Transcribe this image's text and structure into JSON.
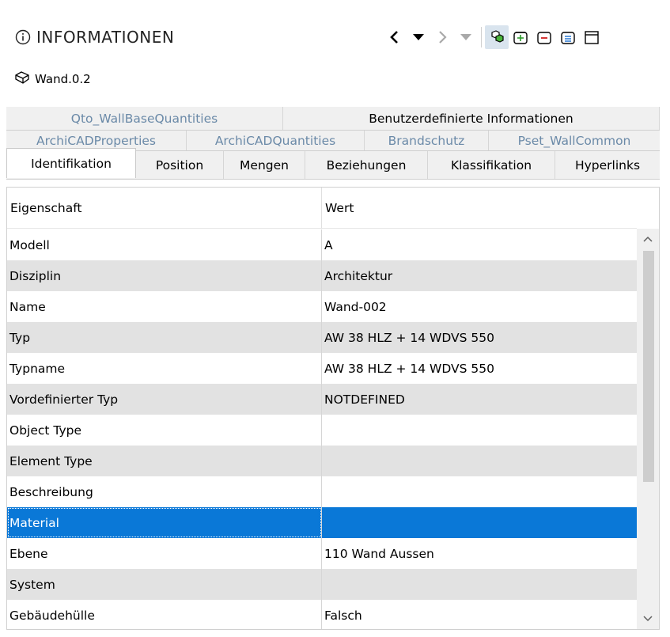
{
  "header": {
    "title": "INFORMATIONEN"
  },
  "element": {
    "name": "Wand.0.2"
  },
  "tabs": {
    "row1": [
      "Qto_WallBaseQuantities",
      "Benutzerdefinierte Informationen"
    ],
    "row2": [
      "ArchiCADProperties",
      "ArchiCADQuantities",
      "Brandschutz",
      "Pset_WallCommon"
    ],
    "row3": [
      "Identifikation",
      "Position",
      "Mengen",
      "Beziehungen",
      "Klassifikation",
      "Hyperlinks"
    ],
    "active": "Identifikation"
  },
  "table": {
    "headers": [
      "Eigenschaft",
      "Wert"
    ],
    "rows": [
      {
        "property": "Modell",
        "value": "A"
      },
      {
        "property": "Disziplin",
        "value": "Architektur"
      },
      {
        "property": "Name",
        "value": "Wand-002"
      },
      {
        "property": "Typ",
        "value": "AW 38 HLZ + 14 WDVS 550"
      },
      {
        "property": "Typname",
        "value": "AW 38 HLZ + 14 WDVS 550"
      },
      {
        "property": "Vordefinierter Typ",
        "value": "NOTDEFINED"
      },
      {
        "property": "Object Type",
        "value": ""
      },
      {
        "property": "Element Type",
        "value": ""
      },
      {
        "property": "Beschreibung",
        "value": ""
      },
      {
        "property": "Material",
        "value": ""
      },
      {
        "property": "Ebene",
        "value": "110 Wand Aussen"
      },
      {
        "property": "System",
        "value": ""
      },
      {
        "property": "Gebäudehülle",
        "value": "Falsch"
      }
    ],
    "selected_row": "Material"
  },
  "colors": {
    "selection": "#0a78d7",
    "row_stripe": "#e2e2e2",
    "muted_tab": "#6b8aa8"
  },
  "icons": [
    "info-icon",
    "back-icon",
    "dropdown-icon",
    "forward-icon",
    "dropdown-disabled-icon",
    "selection-filter-icon",
    "expand-all-icon",
    "collapse-all-icon",
    "list-icon",
    "window-icon",
    "element-cube-icon"
  ]
}
